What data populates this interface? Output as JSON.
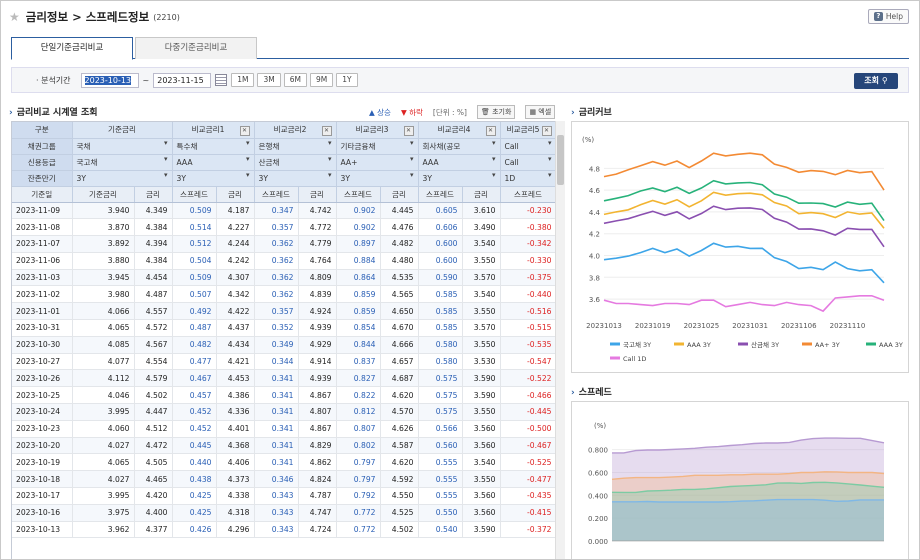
{
  "header": {
    "title": "금리정보 > 스프레드정보",
    "code": "(2210)",
    "help": "Help"
  },
  "tabs": [
    "단일기준금리비교",
    "다중기준금리비교"
  ],
  "filter": {
    "label": "· 분석기간",
    "from": "2023-10-13",
    "sep": "~",
    "to": "2023-11-15",
    "periods": [
      "1M",
      "3M",
      "6M",
      "9M",
      "1Y"
    ],
    "search": "조회"
  },
  "left": {
    "title": "금리비교 시계열 조회",
    "up": "▲ 상승",
    "down": "▼ 하락",
    "unit": "[단위 : %]",
    "reset": "초기화",
    "excel": "엑셀"
  },
  "grid": {
    "hdr1": [
      "구분",
      "기준금리",
      "비교금리1",
      "비교금리2",
      "비교금리3",
      "비교금리4",
      "비교금리5"
    ],
    "hdr2": [
      "채권그룹",
      "국채",
      "특수채",
      "은행채",
      "기타금융채",
      "회사채(공모",
      "Call"
    ],
    "hdr3": [
      "신용등급",
      "국고채",
      "AAA",
      "산금채",
      "AA+",
      "AAA",
      "Call"
    ],
    "hdr4": [
      "잔존만기",
      "3Y",
      "3Y",
      "3Y",
      "3Y",
      "3Y",
      "1D"
    ],
    "colh": [
      "기준일",
      "기준금리",
      "금리",
      "스프레드",
      "금리",
      "스프레드",
      "금리",
      "스프레드",
      "금리",
      "스프레드",
      "금리",
      "스프레드"
    ],
    "rows": [
      [
        "2023-11-09",
        "3.940",
        "4.349",
        "0.509",
        "4.187",
        "0.347",
        "4.742",
        "0.902",
        "4.445",
        "0.605",
        "3.610",
        "-0.230"
      ],
      [
        "2023-11-08",
        "3.870",
        "4.384",
        "0.514",
        "4.227",
        "0.357",
        "4.772",
        "0.902",
        "4.476",
        "0.606",
        "3.490",
        "-0.380"
      ],
      [
        "2023-11-07",
        "3.892",
        "4.394",
        "0.512",
        "4.244",
        "0.362",
        "4.779",
        "0.897",
        "4.482",
        "0.600",
        "3.540",
        "-0.342"
      ],
      [
        "2023-11-06",
        "3.880",
        "4.384",
        "0.504",
        "4.242",
        "0.362",
        "4.764",
        "0.884",
        "4.480",
        "0.600",
        "3.550",
        "-0.330"
      ],
      [
        "2023-11-03",
        "3.945",
        "4.454",
        "0.509",
        "4.307",
        "0.362",
        "4.809",
        "0.864",
        "4.535",
        "0.590",
        "3.570",
        "-0.375"
      ],
      [
        "2023-11-02",
        "3.980",
        "4.487",
        "0.507",
        "4.342",
        "0.362",
        "4.839",
        "0.859",
        "4.565",
        "0.585",
        "3.540",
        "-0.440"
      ],
      [
        "2023-11-01",
        "4.066",
        "4.557",
        "0.492",
        "4.422",
        "0.357",
        "4.924",
        "0.859",
        "4.650",
        "0.585",
        "3.550",
        "-0.516"
      ],
      [
        "2023-10-31",
        "4.065",
        "4.572",
        "0.487",
        "4.437",
        "0.352",
        "4.939",
        "0.854",
        "4.670",
        "0.585",
        "3.570",
        "-0.515"
      ],
      [
        "2023-10-30",
        "4.085",
        "4.567",
        "0.482",
        "4.434",
        "0.349",
        "4.929",
        "0.844",
        "4.666",
        "0.580",
        "3.550",
        "-0.535"
      ],
      [
        "2023-10-27",
        "4.077",
        "4.554",
        "0.477",
        "4.421",
        "0.344",
        "4.914",
        "0.837",
        "4.657",
        "0.580",
        "3.530",
        "-0.547"
      ],
      [
        "2023-10-26",
        "4.112",
        "4.579",
        "0.467",
        "4.453",
        "0.341",
        "4.939",
        "0.827",
        "4.687",
        "0.575",
        "3.590",
        "-0.522"
      ],
      [
        "2023-10-25",
        "4.046",
        "4.502",
        "0.457",
        "4.386",
        "0.341",
        "4.867",
        "0.822",
        "4.620",
        "0.575",
        "3.590",
        "-0.466"
      ],
      [
        "2023-10-24",
        "3.995",
        "4.447",
        "0.452",
        "4.336",
        "0.341",
        "4.807",
        "0.812",
        "4.570",
        "0.575",
        "3.550",
        "-0.445"
      ],
      [
        "2023-10-23",
        "4.060",
        "4.512",
        "0.452",
        "4.401",
        "0.341",
        "4.867",
        "0.807",
        "4.626",
        "0.566",
        "3.560",
        "-0.500"
      ],
      [
        "2023-10-20",
        "4.027",
        "4.472",
        "0.445",
        "4.368",
        "0.341",
        "4.829",
        "0.802",
        "4.587",
        "0.560",
        "3.560",
        "-0.467"
      ],
      [
        "2023-10-19",
        "4.065",
        "4.505",
        "0.440",
        "4.406",
        "0.341",
        "4.862",
        "0.797",
        "4.620",
        "0.555",
        "3.540",
        "-0.525"
      ],
      [
        "2023-10-18",
        "4.027",
        "4.465",
        "0.438",
        "4.373",
        "0.346",
        "4.824",
        "0.797",
        "4.592",
        "0.555",
        "3.550",
        "-0.477"
      ],
      [
        "2023-10-17",
        "3.995",
        "4.420",
        "0.425",
        "4.338",
        "0.343",
        "4.787",
        "0.792",
        "4.550",
        "0.555",
        "3.560",
        "-0.435"
      ],
      [
        "2023-10-16",
        "3.975",
        "4.400",
        "0.425",
        "4.318",
        "0.343",
        "4.747",
        "0.772",
        "4.525",
        "0.550",
        "3.560",
        "-0.415"
      ],
      [
        "2023-10-13",
        "3.962",
        "4.377",
        "0.426",
        "4.296",
        "0.343",
        "4.724",
        "0.772",
        "4.502",
        "0.540",
        "3.590",
        "-0.372"
      ]
    ]
  },
  "curve": {
    "title": "금리커브",
    "yunit": "(%)"
  },
  "spread": {
    "title": "스프레드",
    "yunit": "(%)"
  },
  "chart_data": [
    {
      "type": "line",
      "x": [
        "20231013",
        "20231016",
        "20231017",
        "20231018",
        "20231019",
        "20231020",
        "20231023",
        "20231024",
        "20231025",
        "20231026",
        "20231027",
        "20231030",
        "20231031",
        "20231101",
        "20231102",
        "20231103",
        "20231106",
        "20231107",
        "20231108",
        "20231109",
        "20231110",
        "20231113",
        "20231114",
        "20231115"
      ],
      "xticks": [
        "20231013",
        "20231019",
        "20231025",
        "20231031",
        "20231106",
        "20231110"
      ],
      "yticks": [
        "3.6",
        "3.8",
        "4.0",
        "4.2",
        "4.4",
        "4.6",
        "4.8"
      ],
      "ylim": [
        3.5,
        4.95
      ],
      "series": [
        {
          "name": "국고채 3Y",
          "color": "#3da5e8",
          "values": [
            3.962,
            3.975,
            3.995,
            4.027,
            4.065,
            4.027,
            4.06,
            3.995,
            4.046,
            4.112,
            4.077,
            4.085,
            4.065,
            4.066,
            3.98,
            3.945,
            3.88,
            3.892,
            3.87,
            3.94,
            3.88,
            3.86,
            3.87,
            3.75
          ]
        },
        {
          "name": "AAA 3Y",
          "color": "#f2b431",
          "values": [
            4.377,
            4.4,
            4.42,
            4.465,
            4.505,
            4.472,
            4.512,
            4.447,
            4.502,
            4.579,
            4.554,
            4.567,
            4.572,
            4.557,
            4.487,
            4.454,
            4.384,
            4.394,
            4.384,
            4.349,
            4.4,
            4.38,
            4.39,
            4.25
          ]
        },
        {
          "name": "산금채 3Y",
          "color": "#8a4fb0",
          "values": [
            4.296,
            4.318,
            4.338,
            4.373,
            4.406,
            4.368,
            4.401,
            4.336,
            4.386,
            4.453,
            4.421,
            4.434,
            4.437,
            4.422,
            4.342,
            4.307,
            4.242,
            4.244,
            4.227,
            4.187,
            4.25,
            4.24,
            4.24,
            4.08
          ]
        },
        {
          "name": "AA+ 3Y",
          "color": "#f38a33",
          "values": [
            4.724,
            4.747,
            4.787,
            4.824,
            4.862,
            4.829,
            4.867,
            4.807,
            4.867,
            4.939,
            4.914,
            4.929,
            4.939,
            4.924,
            4.839,
            4.809,
            4.764,
            4.779,
            4.772,
            4.742,
            4.78,
            4.76,
            4.77,
            4.6
          ]
        },
        {
          "name": "AAA 3Y",
          "color": "#27b27a",
          "values": [
            4.502,
            4.525,
            4.55,
            4.592,
            4.62,
            4.587,
            4.626,
            4.57,
            4.62,
            4.687,
            4.657,
            4.666,
            4.67,
            4.65,
            4.565,
            4.535,
            4.48,
            4.482,
            4.476,
            4.445,
            4.49,
            4.47,
            4.48,
            4.32
          ]
        },
        {
          "name": "Call 1D",
          "color": "#e57ae0",
          "values": [
            3.59,
            3.56,
            3.56,
            3.55,
            3.54,
            3.56,
            3.56,
            3.55,
            3.59,
            3.59,
            3.53,
            3.55,
            3.57,
            3.55,
            3.54,
            3.57,
            3.55,
            3.54,
            3.49,
            3.61,
            3.62,
            3.63,
            3.63,
            3.59
          ]
        }
      ]
    },
    {
      "type": "area",
      "yticks": [
        "0.800",
        "0.600",
        "0.400",
        "0.200",
        "0.000",
        "-0.200"
      ],
      "ylim": [
        -0.22,
        0.92
      ],
      "series": [
        {
          "name": "AA+ 3Y",
          "color": "#b79ad2",
          "values": [
            0.772,
            0.772,
            0.792,
            0.797,
            0.797,
            0.802,
            0.807,
            0.812,
            0.822,
            0.827,
            0.837,
            0.844,
            0.854,
            0.859,
            0.859,
            0.864,
            0.884,
            0.897,
            0.902,
            0.902,
            0.9,
            0.9,
            0.88,
            0.86
          ]
        },
        {
          "name": "AAA 3Y",
          "color": "#f3b583",
          "values": [
            0.54,
            0.55,
            0.555,
            0.555,
            0.555,
            0.56,
            0.566,
            0.575,
            0.575,
            0.575,
            0.58,
            0.58,
            0.585,
            0.585,
            0.585,
            0.59,
            0.6,
            0.6,
            0.606,
            0.605,
            0.6,
            0.6,
            0.6,
            0.59
          ]
        },
        {
          "name": "AAA 3Y",
          "color": "#7ccba3",
          "values": [
            0.426,
            0.425,
            0.425,
            0.438,
            0.44,
            0.445,
            0.452,
            0.452,
            0.457,
            0.467,
            0.477,
            0.482,
            0.487,
            0.492,
            0.507,
            0.509,
            0.504,
            0.512,
            0.514,
            0.509,
            0.5,
            0.49,
            0.48,
            0.47
          ]
        },
        {
          "name": "산금채 3Y",
          "color": "#7fb8e6",
          "values": [
            0.343,
            0.343,
            0.343,
            0.346,
            0.341,
            0.341,
            0.341,
            0.341,
            0.341,
            0.341,
            0.344,
            0.349,
            0.352,
            0.357,
            0.362,
            0.362,
            0.362,
            0.362,
            0.357,
            0.347,
            0.35,
            0.36,
            0.36,
            0.36
          ]
        }
      ]
    }
  ]
}
